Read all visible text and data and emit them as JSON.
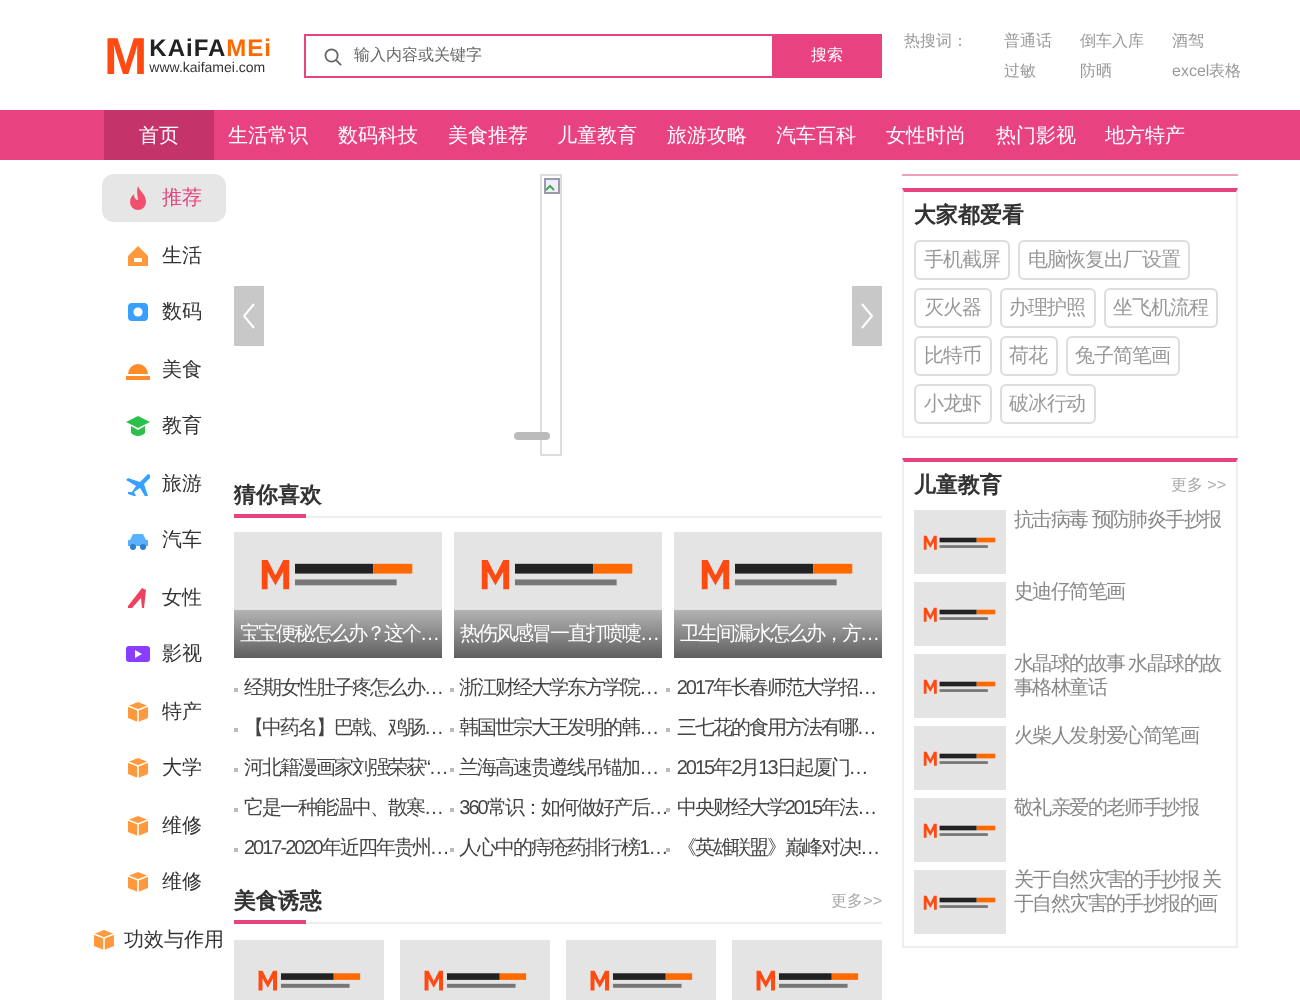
{
  "logo": {
    "mark": "M",
    "name_dark": "KAiFA",
    "name_accent": "MEi",
    "url": "www.kaifamei.com"
  },
  "search": {
    "placeholder": "输入内容或关键字",
    "button": "搜索"
  },
  "hot_search": {
    "label": "热搜词：",
    "words": [
      "普通话",
      "倒车入库",
      "酒驾",
      "过敏",
      "防晒",
      "excel表格"
    ]
  },
  "nav": [
    {
      "label": "首页",
      "selected": true
    },
    {
      "label": "生活常识",
      "selected": false
    },
    {
      "label": "数码科技",
      "selected": false
    },
    {
      "label": "美食推荐",
      "selected": false
    },
    {
      "label": "儿童教育",
      "selected": false
    },
    {
      "label": "旅游攻略",
      "selected": false
    },
    {
      "label": "汽车百科",
      "selected": false
    },
    {
      "label": "女性时尚",
      "selected": false
    },
    {
      "label": "热门影视",
      "selected": false
    },
    {
      "label": "地方特产",
      "selected": false
    }
  ],
  "sidebar": [
    {
      "label": "推荐",
      "kind": "fire",
      "selected": true
    },
    {
      "label": "生活",
      "kind": "house",
      "selected": false
    },
    {
      "label": "数码",
      "kind": "camera",
      "selected": false
    },
    {
      "label": "美食",
      "kind": "dish",
      "selected": false
    },
    {
      "label": "教育",
      "kind": "cap",
      "selected": false
    },
    {
      "label": "旅游",
      "kind": "plane",
      "selected": false
    },
    {
      "label": "汽车",
      "kind": "car",
      "selected": false
    },
    {
      "label": "女性",
      "kind": "heel",
      "selected": false
    },
    {
      "label": "影视",
      "kind": "video",
      "selected": false
    },
    {
      "label": "特产",
      "kind": "box",
      "selected": false
    },
    {
      "label": "大学",
      "kind": "box",
      "selected": false
    },
    {
      "label": "维修",
      "kind": "box",
      "selected": false
    },
    {
      "label": "维修",
      "kind": "box",
      "selected": false
    },
    {
      "label": "功效与作用",
      "kind": "box",
      "selected": false
    }
  ],
  "guess": {
    "title": "猜你喜欢",
    "cards": [
      "宝宝便秘怎么办？这个…",
      "热伤风感冒一直打喷嚏…",
      "卫生间漏水怎么办，方…"
    ],
    "links": [
      [
        "经期女性肚子疼怎么办…",
        "浙江财经大学东方学院…",
        "2017年长春师范大学招…"
      ],
      [
        "【中药名】巴戟、鸡肠…",
        "韩国世宗大王发明的韩…",
        "三七花的食用方法有哪…"
      ],
      [
        "河北籍漫画家刘强荣获“…",
        "兰海高速贵遵线吊锚加…",
        "2015年2月13日起厦门…"
      ],
      [
        "它是一种能温中、散寒…",
        "360常识：如何做好产后…",
        "中央财经大学2015年法…"
      ],
      [
        "2017-2020年近四年贵州…",
        "人心中的痔疮药排行榜1…",
        "《英雄联盟》巅峰对决!…"
      ]
    ]
  },
  "food": {
    "title": "美食诱惑",
    "more": "更多>>"
  },
  "popular": {
    "title": "大家都爱看",
    "tags": [
      "手机截屏",
      "电脑恢复出厂设置",
      "灭火器",
      "办理护照",
      "坐飞机流程",
      "比特币",
      "荷花",
      "兔子简笔画",
      "小龙虾",
      "破冰行动"
    ]
  },
  "kids": {
    "title": "儿童教育",
    "more": "更多 >>",
    "items": [
      "抗击病毒 预防肺炎手抄报",
      "史迪仔简笔画",
      "水晶球的故事 水晶球的故事格林童话",
      "火柴人发射爱心简笔画",
      "敬礼亲爱的老师手抄报",
      "关于自然灾害的手抄报 关于自然灾害的手抄报的画"
    ]
  }
}
